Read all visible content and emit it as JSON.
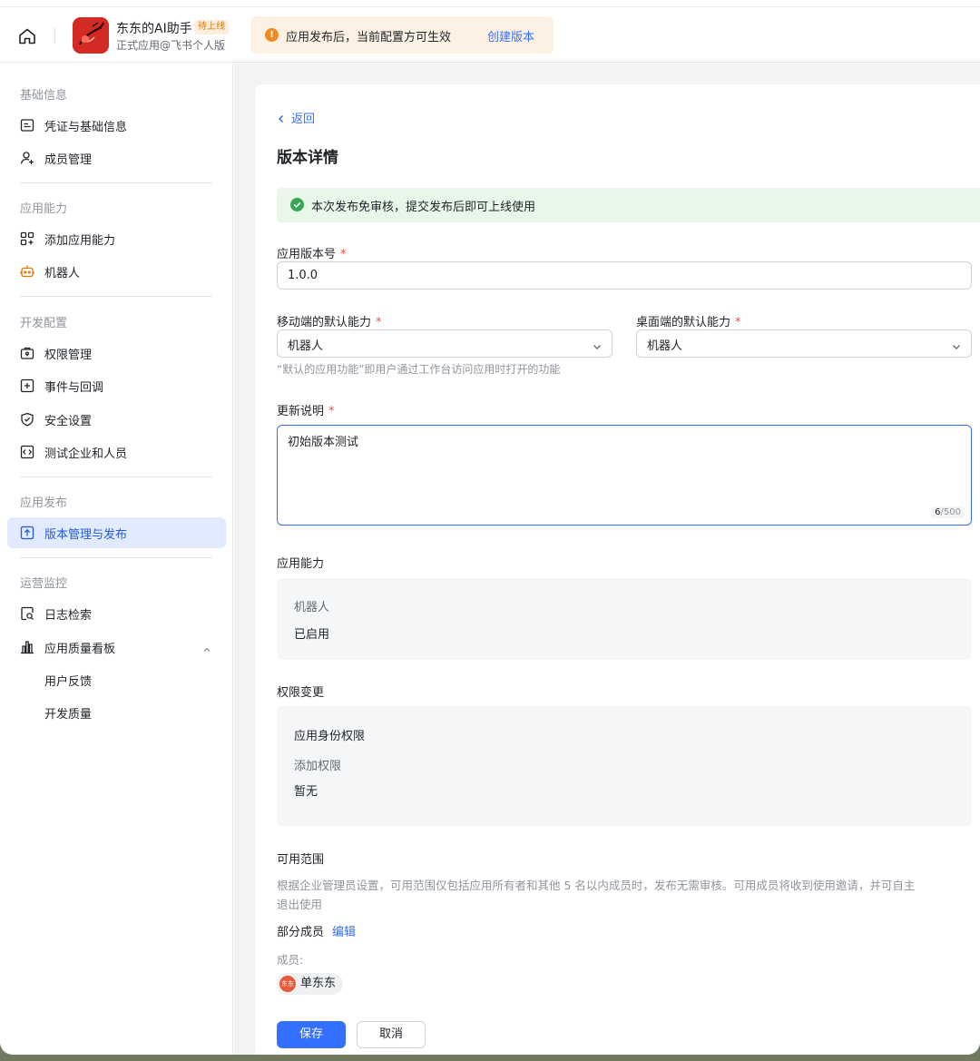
{
  "header": {
    "app_name": "东东的AI助手",
    "app_badge": "待上线",
    "app_subtitle": "正式应用@飞书个人版",
    "notice_text": "应用发布后，当前配置方可生效",
    "notice_link": "创建版本"
  },
  "sidebar": {
    "sections": [
      {
        "title": "基础信息",
        "items": [
          {
            "label": "凭证与基础信息",
            "icon": "credential-icon"
          },
          {
            "label": "成员管理",
            "icon": "member-add-icon"
          }
        ]
      },
      {
        "title": "应用能力",
        "items": [
          {
            "label": "添加应用能力",
            "icon": "add-grid-icon"
          },
          {
            "label": "机器人",
            "icon": "robot-icon"
          }
        ]
      },
      {
        "title": "开发配置",
        "items": [
          {
            "label": "权限管理",
            "icon": "permission-icon"
          },
          {
            "label": "事件与回调",
            "icon": "event-icon"
          },
          {
            "label": "安全设置",
            "icon": "shield-icon"
          },
          {
            "label": "测试企业和人员",
            "icon": "code-icon"
          }
        ]
      },
      {
        "title": "应用发布",
        "items": [
          {
            "label": "版本管理与发布",
            "icon": "upload-icon"
          }
        ]
      },
      {
        "title": "运营监控",
        "items": [
          {
            "label": "日志检索",
            "icon": "log-search-icon"
          },
          {
            "label": "应用质量看板",
            "icon": "chart-icon"
          }
        ],
        "sub_items": [
          "用户反馈",
          "开发质量"
        ]
      }
    ]
  },
  "main": {
    "back_label": "返回",
    "page_title": "版本详情",
    "success_text": "本次发布免审核，提交发布后即可上线使用",
    "version": {
      "label": "应用版本号",
      "required": "*",
      "value": "1.0.0"
    },
    "mobile_default": {
      "label": "移动端的默认能力",
      "required": "*",
      "value": "机器人"
    },
    "desktop_default": {
      "label": "桌面端的默认能力",
      "required": "*",
      "value": "机器人"
    },
    "default_hint": "“默认的应用功能”即用户通过工作台访问应用时打开的功能",
    "update_note": {
      "label": "更新说明",
      "required": "*",
      "value": "初始版本测试",
      "count_current": "6",
      "count_max": "/500"
    },
    "capabilities": {
      "title": "应用能力",
      "item_name": "机器人",
      "item_status": "已启用"
    },
    "permissions": {
      "title": "权限变更",
      "group_title": "应用身份权限",
      "sub_title": "添加权限",
      "value": "暂无"
    },
    "scope": {
      "title": "可用范围",
      "desc_line1": "根据企业管理员设置，可用范围仅包括应用所有者和其他 5 名以内成员时，发布无需审核。可用成员将收到使用邀请，并可自主",
      "desc_line2": "退出使用",
      "mode": "部分成员",
      "edit_link": "编辑",
      "members_label": "成员:",
      "member": {
        "avatar_text": "东东",
        "name": "单东东"
      }
    },
    "actions": {
      "save": "保存",
      "cancel": "取消"
    }
  },
  "colors": {
    "primary": "#3370ff",
    "success_bg": "#e8f7e8",
    "notice_bg": "#fdf1e3",
    "active_nav_bg": "#e1eaff"
  }
}
